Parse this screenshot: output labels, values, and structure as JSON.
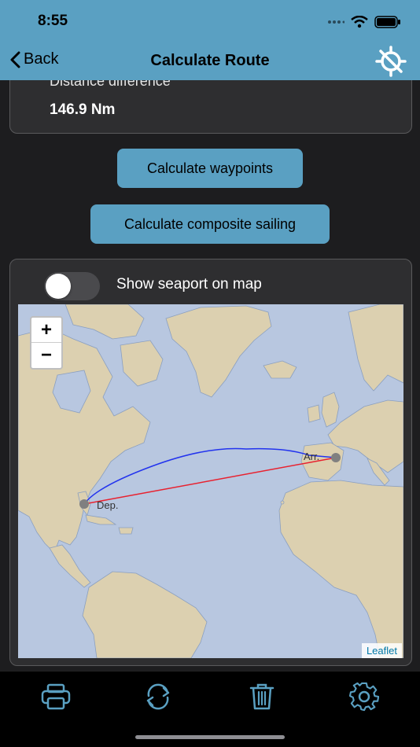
{
  "status_bar": {
    "time": "8:55"
  },
  "nav": {
    "back_label": "Back",
    "title": "Calculate Route",
    "action_icon": "location-disabled-icon"
  },
  "result": {
    "label": "Distance difference",
    "value": "146.9 Nm"
  },
  "buttons": {
    "waypoints": "Calculate waypoints",
    "composite": "Calculate composite sailing"
  },
  "map_section": {
    "toggle_label": "Show seaport on map",
    "toggle_on": false,
    "zoom_in": "+",
    "zoom_out": "−",
    "attribution": "Leaflet",
    "departure_label": "Dep.",
    "arrival_label": "Arr.",
    "colors": {
      "ocean": "#b8c7e0",
      "land": "#dcd0b0",
      "great_circle": "#2233ee",
      "rhumb_line": "#e8212f",
      "port_marker": "#808080"
    }
  },
  "tabbar": {
    "icons": [
      "printer-icon",
      "refresh-icon",
      "trash-icon",
      "gear-icon"
    ]
  },
  "colors": {
    "accent": "#5aa0c2",
    "card": "#2e2e30",
    "background": "#1d1d1f"
  }
}
